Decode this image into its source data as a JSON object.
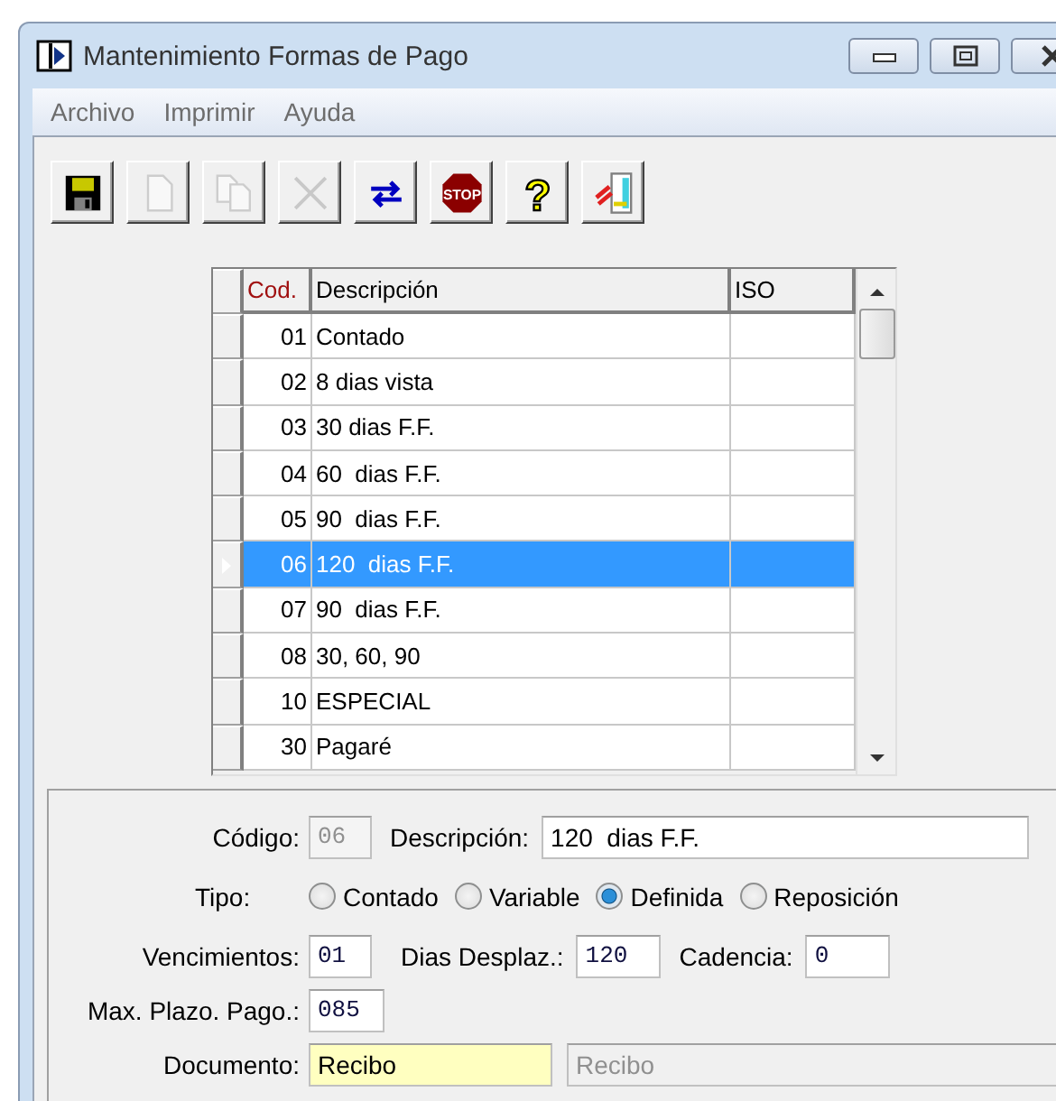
{
  "window": {
    "title": "Mantenimiento Formas de Pago"
  },
  "menu": [
    "Archivo",
    "Imprimir",
    "Ayuda"
  ],
  "toolbar": [
    {
      "kind": "save",
      "disabled": false
    },
    {
      "kind": "new",
      "disabled": true
    },
    {
      "kind": "copy",
      "disabled": true
    },
    {
      "kind": "delete",
      "disabled": true
    },
    {
      "kind": "refresh",
      "disabled": false
    },
    {
      "kind": "stop",
      "text": "STOP",
      "disabled": false
    },
    {
      "kind": "help",
      "text": "?",
      "disabled": false
    },
    {
      "kind": "exit",
      "disabled": false
    }
  ],
  "grid": {
    "columns": [
      "Cod.",
      "Descripción",
      "ISO"
    ],
    "rows": [
      {
        "cod": "01",
        "descripcion": "Contado",
        "selected": false
      },
      {
        "cod": "02",
        "descripcion": "8 dias vista",
        "selected": false
      },
      {
        "cod": "03",
        "descripcion": "30 dias F.F.",
        "selected": false
      },
      {
        "cod": "04",
        "descripcion": "60  dias F.F.",
        "selected": false
      },
      {
        "cod": "05",
        "descripcion": "90  dias F.F.",
        "selected": false
      },
      {
        "cod": "06",
        "descripcion": "120  dias F.F.",
        "selected": true
      },
      {
        "cod": "07",
        "descripcion": "90  dias F.F.",
        "selected": false
      },
      {
        "cod": "08",
        "descripcion": "30, 60, 90",
        "selected": false
      },
      {
        "cod": "10",
        "descripcion": "ESPECIAL",
        "selected": false
      },
      {
        "cod": "30",
        "descripcion": "Pagaré",
        "selected": false
      }
    ]
  },
  "form": {
    "codigo": {
      "label": "Código:",
      "value": "06",
      "disabled": true
    },
    "descripcion": {
      "label": "Descripción:",
      "value": "120  dias F.F.",
      "disabled": false
    },
    "tipo": {
      "label": "Tipo:",
      "options": [
        {
          "label": "Contado",
          "selected": false
        },
        {
          "label": "Variable",
          "selected": false
        },
        {
          "label": "Definida",
          "selected": true
        },
        {
          "label": "Reposición",
          "selected": false
        }
      ]
    },
    "vencimientos": {
      "label": "Vencimientos:",
      "value": "01",
      "disabled": false
    },
    "dias_desplaz": {
      "label": "Dias Desplaz.:",
      "value": "120",
      "disabled": false
    },
    "cadencia": {
      "label": "Cadencia:",
      "value": "0",
      "disabled": false
    },
    "max_plazo": {
      "label": "Max. Plazo. Pago.:",
      "value": "085",
      "disabled": false
    },
    "documento": {
      "label": "Documento:",
      "value": "Recibo",
      "highlighted": true,
      "disabled": false
    },
    "documento_nombre": {
      "value": "Recibo",
      "disabled": true
    }
  }
}
